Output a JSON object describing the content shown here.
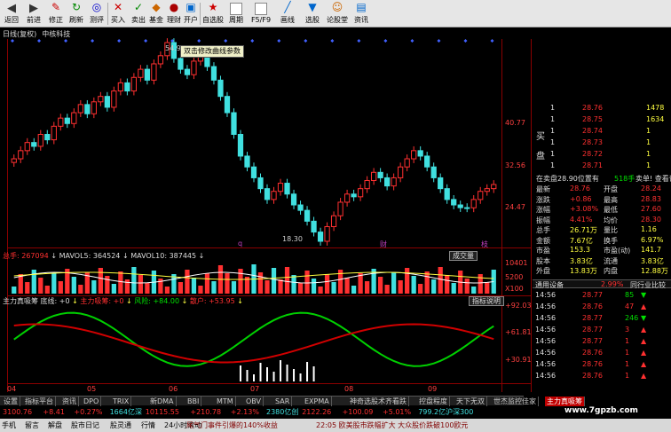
{
  "toolbar": {
    "items": [
      "返回",
      "前进",
      "修正",
      "刷新",
      "测评",
      "买入",
      "卖出",
      "基金",
      "理财",
      "开户",
      "自选股",
      "周期",
      "F5/F9",
      "画线",
      "选股",
      "论股堂",
      "资讯"
    ]
  },
  "chart_title": [
    "日线(复权)",
    "中核科技"
  ],
  "tooltip": "双击修改曲线参数",
  "price_panel": {
    "axis": [
      "40.77",
      "32.56",
      "24.47"
    ],
    "high_label": "54.92",
    "low_label": "18.30",
    "markers": [
      "q",
      "财",
      "枝"
    ]
  },
  "volume_panel": {
    "title": "总手: 267094",
    "mavol5": "MAVOL5: 364524",
    "mavol10": "MAVOL10: 387445",
    "button": "成交量",
    "axis": [
      "10401",
      "5200",
      "X100"
    ]
  },
  "indicator_panel": {
    "title": "主力真吸筹",
    "line1": "底线: +0",
    "line2": "主力吸筹: +0",
    "line3": "风险: +84.00",
    "line4": "散户: +53.95",
    "button": "指标说明",
    "axis": [
      "+92.03",
      "+61.81",
      "+30.91"
    ]
  },
  "x_axis": [
    "04",
    "05",
    "06",
    "07",
    "08",
    "09"
  ],
  "order_book": {
    "sell_label": "卖",
    "buy_label": "买",
    "disk_label": "盘",
    "rows": [
      {
        "level": "1",
        "price": "28.76",
        "vol": "1478"
      },
      {
        "level": "1",
        "price": "28.75",
        "vol": "1634"
      },
      {
        "level": "1",
        "price": "28.74",
        "vol": "1"
      },
      {
        "level": "1",
        "price": "28.73",
        "vol": "1"
      },
      {
        "level": "1",
        "price": "28.72",
        "vol": "1"
      },
      {
        "level": "1",
        "price": "28.71",
        "vol": "1"
      }
    ],
    "note1": "在卖盘28.90位置有",
    "note2": "518手",
    "note3": "卖单! 查看详细"
  },
  "quote": [
    {
      "l1": "最新",
      "v1": "28.76",
      "l2": "开盘",
      "v2": "28.24"
    },
    {
      "l1": "涨跌",
      "v1": "+0.86",
      "l2": "最高",
      "v2": "28.83"
    },
    {
      "l1": "涨幅",
      "v1": "+3.08%",
      "l2": "最低",
      "v2": "27.60"
    },
    {
      "l1": "振幅",
      "v1": "4.41%",
      "l2": "均价",
      "v2": "28.30"
    },
    {
      "l1": "总手",
      "v1": "26.71万",
      "l2": "量比",
      "v2": "1.16"
    },
    {
      "l1": "金额",
      "v1": "7.67亿",
      "l2": "换手",
      "v2": "6.97%"
    },
    {
      "l1": "市盈",
      "v1": "153.3",
      "l2": "市盈(动)",
      "v2": "141.7"
    },
    {
      "l1": "股本",
      "v1": "3.83亿",
      "l2": "流通",
      "v2": "3.83亿"
    },
    {
      "l1": "外盘",
      "v1": "13.83万",
      "l2": "内盘",
      "v2": "12.88万"
    }
  ],
  "ticks_header": {
    "left": "通用设备",
    "mid": "2.99%",
    "right": "同行业比较"
  },
  "ticks": [
    {
      "time": "14:56",
      "price": "28.77",
      "vol": "85",
      "dir": "down"
    },
    {
      "time": "14:56",
      "price": "28.76",
      "vol": "47",
      "dir": "up"
    },
    {
      "time": "14:56",
      "price": "28.77",
      "vol": "246",
      "dir": "down"
    },
    {
      "time": "14:56",
      "price": "28.77",
      "vol": "3",
      "dir": "up"
    },
    {
      "time": "14:56",
      "price": "28.77",
      "vol": "1",
      "dir": "up"
    },
    {
      "time": "14:56",
      "price": "28.76",
      "vol": "1",
      "dir": "up"
    },
    {
      "time": "14:56",
      "price": "28.76",
      "vol": "1",
      "dir": "up"
    },
    {
      "time": "14:56",
      "price": "28.76",
      "vol": "1",
      "dir": "up"
    }
  ],
  "tabs": [
    "设置",
    "指标平台",
    "资讯",
    "DPO",
    "TRIX",
    "新DMA",
    "BBI",
    "MTM",
    "OBV",
    "SAR",
    "EXPMA",
    "神奇选股术齐看跌",
    "控盘程度",
    "天下无双",
    "世杰监控佳家",
    "主力真吸筹"
  ],
  "tickers": [
    {
      "text": "3100.76",
      "color": "#ff3030"
    },
    {
      "text": "+8.41",
      "color": "#ff3030"
    },
    {
      "text": "+0.27%",
      "color": "#ff3030"
    },
    {
      "text": "1664亿深",
      "color": "#40e0e0"
    },
    {
      "text": "10115.55",
      "color": "#ff3030"
    },
    {
      "text": "+210.78",
      "color": "#ff3030"
    },
    {
      "text": "+2.13%",
      "color": "#ff3030"
    },
    {
      "text": "2380亿创",
      "color": "#40e0e0"
    },
    {
      "text": "2122.26",
      "color": "#ff3030"
    },
    {
      "text": "+100.09",
      "color": "#ff3030"
    },
    {
      "text": "+5.01%",
      "color": "#ff3030"
    },
    {
      "text": "799.2亿沪深300",
      "color": "#40e0e0"
    }
  ],
  "status": {
    "items": [
      "手机",
      "留言",
      "解盘",
      "股市日记",
      "股灵通",
      "行情",
      "24小时滚动"
    ],
    "news1": "尾气门事件引爆的140%收益",
    "news2": "22:05 欧美股市跌幅扩大 大众股价跌破100欧元"
  },
  "watermark": "www.7gpzb.com",
  "chart_data": {
    "type": "candlestick",
    "title": "中核科技",
    "x": [
      "04",
      "05",
      "06",
      "07",
      "08",
      "09"
    ],
    "price_ylim": [
      18.3,
      54.92
    ],
    "price_ticks": [
      24.47,
      32.56,
      40.77
    ],
    "close_series": [
      33.5,
      35.0,
      36.5,
      35.8,
      38.0,
      37.0,
      39.5,
      41.0,
      40.0,
      42.0,
      43.5,
      41.8,
      44.0,
      45.0,
      43.0,
      46.0,
      47.5,
      46.0,
      48.5,
      50.0,
      48.0,
      51.0,
      52.5,
      54.92,
      52.0,
      50.0,
      49.0,
      51.5,
      53.0,
      50.5,
      48.0,
      45.0,
      42.0,
      38.0,
      34.0,
      32.0,
      30.0,
      28.0,
      26.0,
      27.5,
      29.0,
      27.0,
      25.0,
      24.0,
      22.0,
      20.0,
      18.3,
      21.0,
      23.0,
      25.5,
      27.0,
      26.5,
      28.0,
      29.5,
      31.0,
      30.0,
      28.5,
      30.0,
      32.0,
      33.5,
      35.0,
      34.0,
      32.0,
      30.0,
      28.0,
      26.0,
      25.0,
      24.5,
      24.47,
      26.0,
      27.5,
      28.0,
      28.76
    ],
    "volume_ticks": [
      5200,
      10401
    ],
    "indicator_ticks": [
      30.91,
      61.81,
      92.03
    ]
  }
}
